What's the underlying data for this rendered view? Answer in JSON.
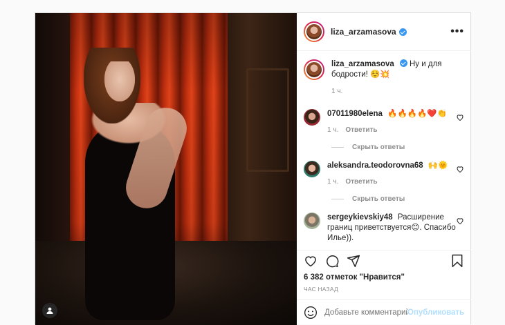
{
  "post": {
    "author": "liza_arzamasova",
    "caption_text": "Ну и для бодрости! ☺️💥",
    "caption_time": "1 ч.",
    "likes_count": "6 382",
    "likes_label": "отметок \"Нравится\"",
    "posted_ago": "ЧАС НАЗАД"
  },
  "comments": [
    {
      "user": "07011980elena",
      "text": "🔥🔥🔥🔥❤️👏",
      "time": "1 ч.",
      "reply_label": "Ответить",
      "hide_replies": "Скрыть ответы"
    },
    {
      "user": "aleksandra.teodorovna68",
      "text": "🙌🌞",
      "time": "1 ч.",
      "reply_label": "Ответить",
      "hide_replies": "Скрыть ответы"
    },
    {
      "user": "sergeykievskiy48",
      "text": "Расширение границ приветствуется😊. Спасибо Илье))."
    }
  ],
  "add_comment": {
    "placeholder": "Добавьте комментарий...",
    "publish_label": "Опубликовать"
  },
  "colors": {
    "verified": "#3897f0",
    "publish_disabled": "#b2dffc"
  },
  "icons": [
    "more-options-icon",
    "verified-icon",
    "heart-icon",
    "comment-icon",
    "share-icon",
    "bookmark-icon",
    "emoji-icon",
    "user-tag-icon"
  ]
}
